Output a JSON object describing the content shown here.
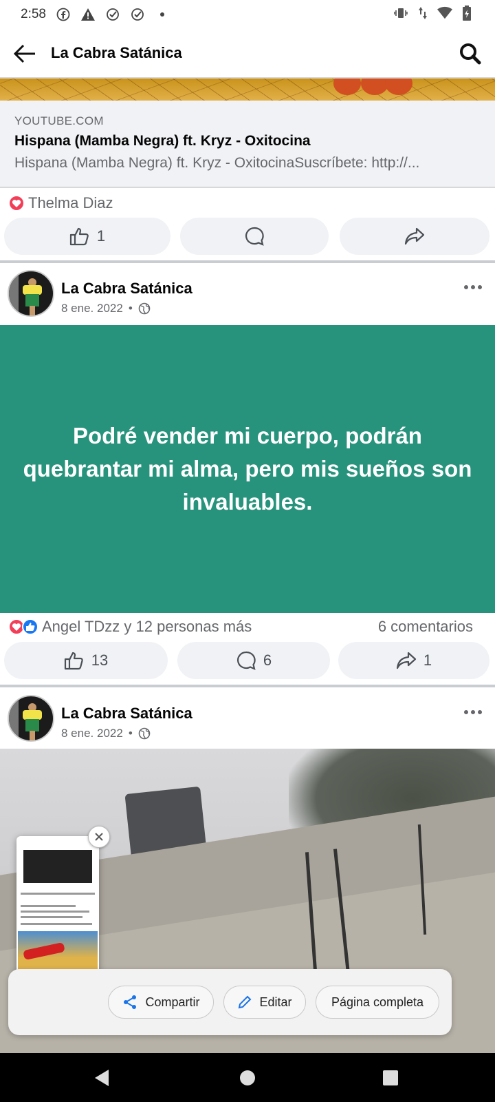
{
  "status_bar": {
    "time": "2:58"
  },
  "app_bar": {
    "title": "La Cabra Satánica"
  },
  "link_preview": {
    "domain": "YOUTUBE.COM",
    "title": "Hispana (Mamba Negra) ft. Kryz - Oxitocina",
    "description": "Hispana (Mamba Negra) ft. Kryz - OxitocinaSuscríbete: http://..."
  },
  "post1": {
    "reaction_names": "Thelma Diaz",
    "like_count": "1"
  },
  "post2": {
    "author": "La Cabra Satánica",
    "date": "8 ene. 2022",
    "meta_separator": "•",
    "text": "Podré vender mi cuerpo, podrán quebrantar mi alma, pero mis sueños son invaluables.",
    "reaction_names": "Angel TDzz y 12 personas más",
    "comments_label": "6 comentarios",
    "like_count": "13",
    "comment_count": "6",
    "share_count": "1",
    "background_color": "#27937c"
  },
  "post3": {
    "author": "La Cabra Satánica",
    "date": "8 ene. 2022",
    "meta_separator": "•"
  },
  "share_sheet": {
    "share_label": "Compartir",
    "edit_label": "Editar",
    "full_page_label": "Página completa"
  },
  "colors": {
    "brand_blue": "#1877f2",
    "heart_red": "#f33e58",
    "share_blue": "#1a73e8"
  }
}
